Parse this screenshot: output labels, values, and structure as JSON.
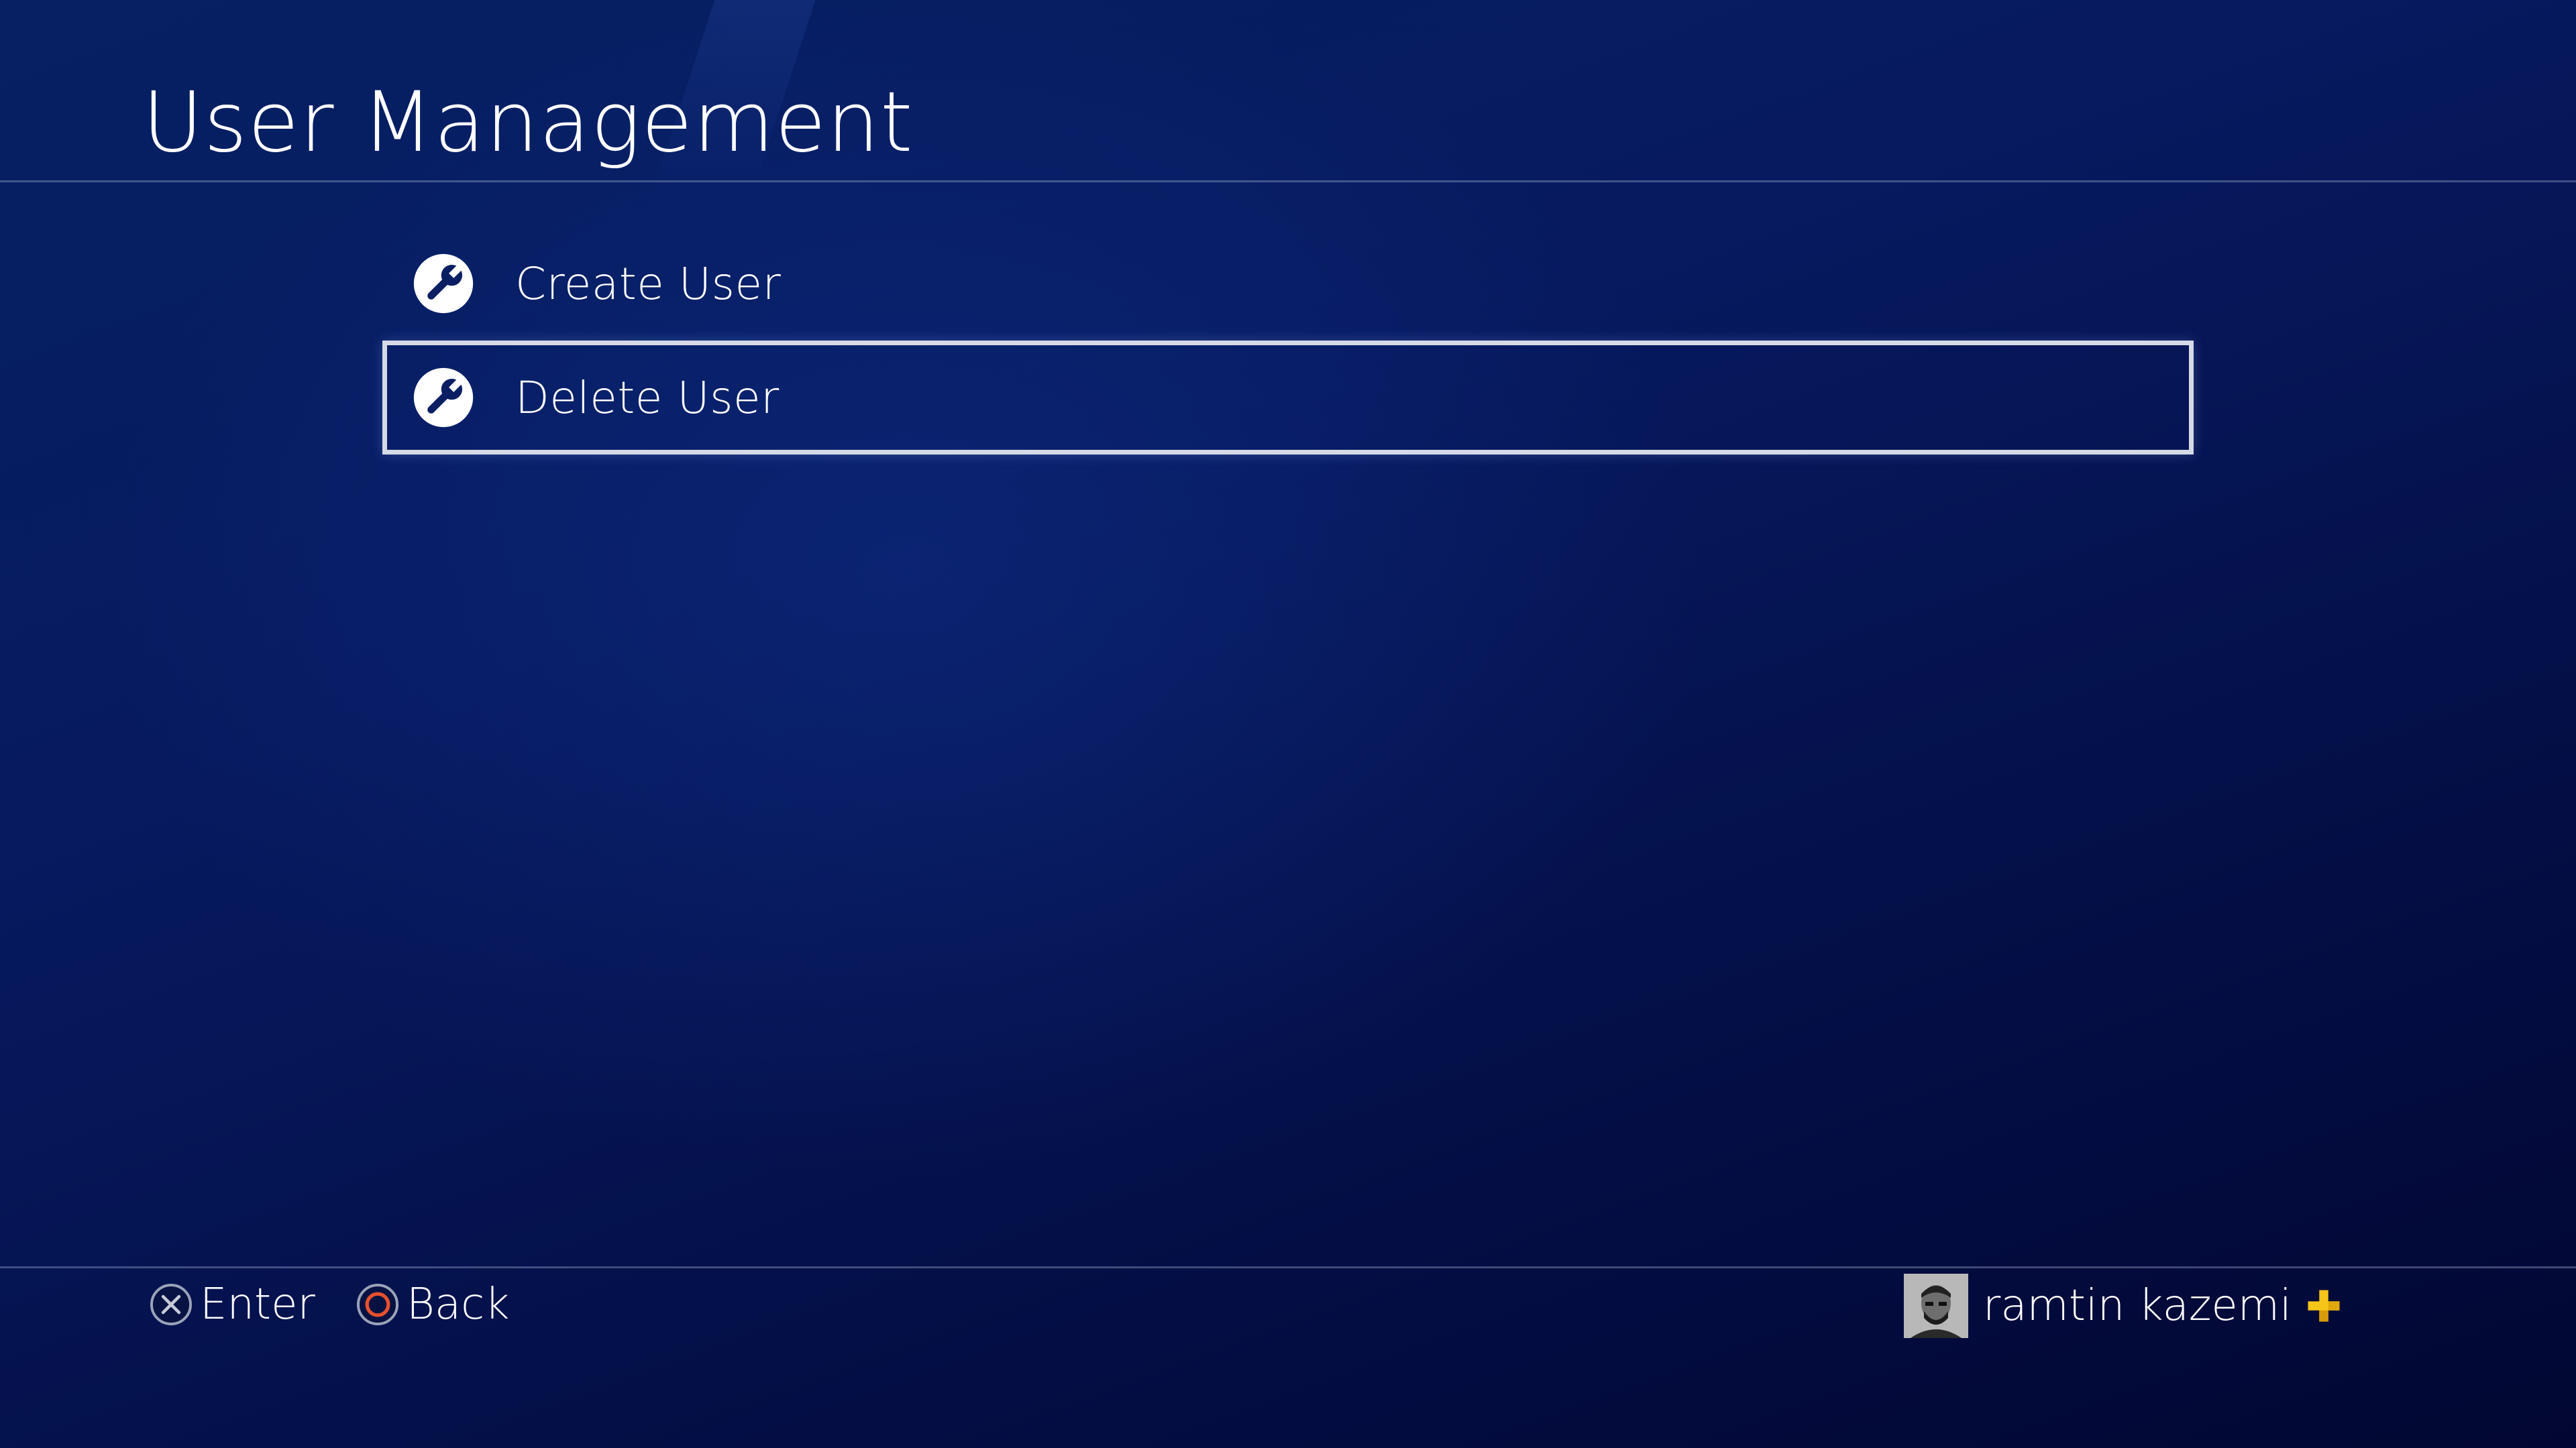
{
  "header": {
    "title": "User Management"
  },
  "menu": {
    "items": [
      {
        "label": "Create User",
        "icon": "wrench-icon"
      },
      {
        "label": "Delete User",
        "icon": "wrench-icon",
        "focused": true
      }
    ]
  },
  "footer": {
    "enter_label": "Enter",
    "enter_icon": "cross-button-icon",
    "back_label": "Back",
    "back_icon": "circle-button-icon",
    "user": {
      "name": "ramtin kazemi",
      "avatar": "avatar",
      "badge_icon": "playstation-plus-icon"
    }
  },
  "colors": {
    "background": "#061a5e",
    "focus_border": "#d5dae6",
    "circle_button": "#e8502d",
    "plus_badge": "#f5c518"
  }
}
